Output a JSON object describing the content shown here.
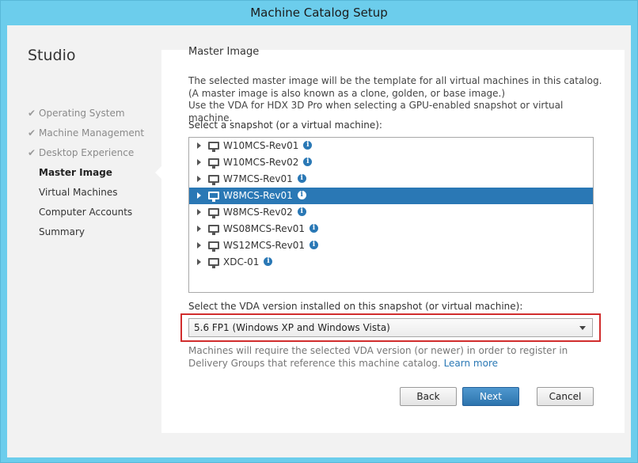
{
  "window": {
    "title": "Machine Catalog Setup"
  },
  "sidebar": {
    "app_title": "Studio",
    "steps": [
      {
        "label": "Operating System",
        "state": "done"
      },
      {
        "label": "Machine Management",
        "state": "done"
      },
      {
        "label": "Desktop Experience",
        "state": "done"
      },
      {
        "label": "Master Image",
        "state": "active"
      },
      {
        "label": "Virtual Machines",
        "state": "pending"
      },
      {
        "label": "Computer Accounts",
        "state": "pending"
      },
      {
        "label": "Summary",
        "state": "pending"
      }
    ]
  },
  "main": {
    "title": "Master Image",
    "description_1": "The selected master image will be the template for all virtual machines in this catalog. (A master image is also known as a clone, golden, or base image.)",
    "description_2": "Use the VDA for HDX 3D Pro when selecting a GPU-enabled snapshot or virtual machine.",
    "snapshot_label": "Select a snapshot (or a virtual machine):",
    "snapshots": [
      {
        "name": "W10MCS-Rev01",
        "selected": false
      },
      {
        "name": "W10MCS-Rev02",
        "selected": false
      },
      {
        "name": "W7MCS-Rev01",
        "selected": false
      },
      {
        "name": "W8MCS-Rev01",
        "selected": true
      },
      {
        "name": "W8MCS-Rev02",
        "selected": false
      },
      {
        "name": "WS08MCS-Rev01",
        "selected": false
      },
      {
        "name": "WS12MCS-Rev01",
        "selected": false
      },
      {
        "name": "XDC-01",
        "selected": false
      }
    ],
    "vda_label": "Select the VDA version installed on this snapshot (or virtual machine):",
    "vda_selected": "5.6 FP1 (Windows XP and Windows Vista)",
    "note_text": "Machines will require the selected VDA version (or newer) in order to register in Delivery Groups that reference this machine catalog.",
    "note_link": "Learn more",
    "info_glyph": "i"
  },
  "buttons": {
    "back": "Back",
    "next": "Next",
    "cancel": "Cancel"
  },
  "colors": {
    "accent": "#2a78b5",
    "highlight": "#d12d2d",
    "titlebar": "#6ccdec"
  }
}
